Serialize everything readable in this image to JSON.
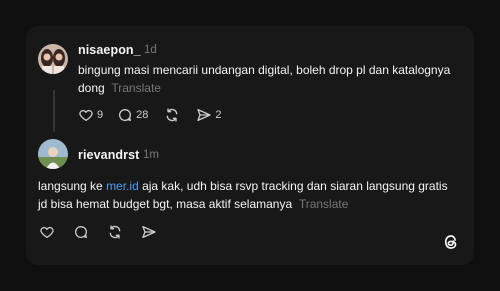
{
  "post1": {
    "username": "nisaepon_",
    "time": "1d",
    "text": "bingung masi mencarii undangan digital, boleh drop pl dan katalognya dong",
    "translate": "Translate",
    "likes": "9",
    "replies": "28",
    "shares": "2"
  },
  "post2": {
    "username": "rievandrst",
    "time": "1m",
    "text_before": "langsung ke ",
    "mention": "mer.id",
    "text_after": " aja kak, udh bisa rsvp tracking dan siaran langsung gratis jd bisa hemat budget bgt, masa aktif selamanya",
    "translate": "Translate"
  },
  "icons": {
    "like": "heart-icon",
    "reply": "comment-icon",
    "repost": "repost-icon",
    "share": "send-icon",
    "brand": "threads-logo-icon"
  },
  "colors": {
    "background": "#0f0f0f",
    "card": "#181818",
    "text": "#f3f5f7",
    "muted": "#777777",
    "mention": "#4a9eff"
  }
}
